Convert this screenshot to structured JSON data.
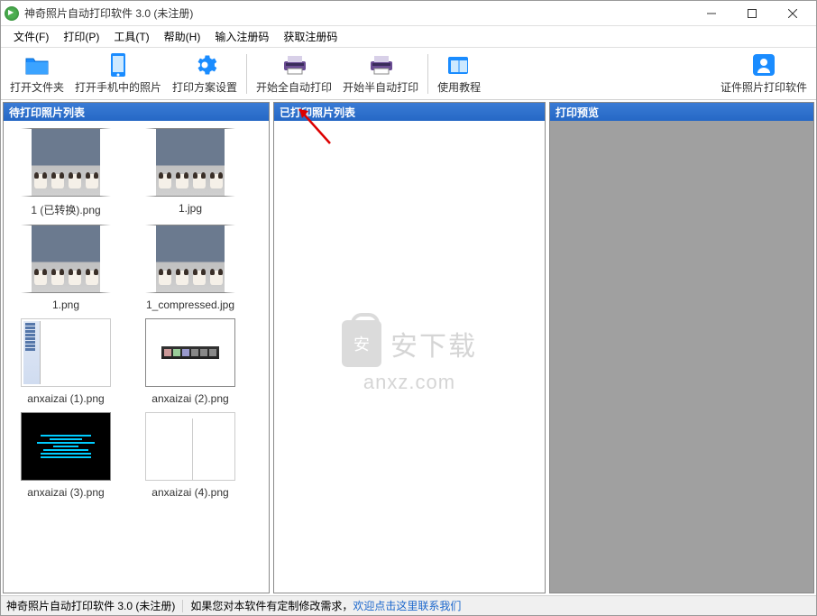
{
  "window": {
    "title": "神奇照片自动打印软件 3.0 (未注册)"
  },
  "menu": {
    "file": "文件(F)",
    "print": "打印(P)",
    "tools": "工具(T)",
    "help": "帮助(H)",
    "enter_reg": "输入注册码",
    "get_reg": "获取注册码"
  },
  "toolbar": {
    "open_folder": "打开文件夹",
    "open_phone": "打开手机中的照片",
    "print_plan": "打印方案设置",
    "start_auto": "开始全自动打印",
    "start_semi": "开始半自动打印",
    "tutorial": "使用教程",
    "id_photo": "证件照片打印软件"
  },
  "panels": {
    "pending": "待打印照片列表",
    "printed": "已打印照片列表",
    "preview": "打印预览"
  },
  "thumbs": [
    {
      "label": "1 (已转换).png",
      "kind": "puppy"
    },
    {
      "label": "1.jpg",
      "kind": "puppy"
    },
    {
      "label": "1.png",
      "kind": "puppy"
    },
    {
      "label": "1_compressed.jpg",
      "kind": "puppy"
    },
    {
      "label": "anxaizai (1).png",
      "kind": "screenshot"
    },
    {
      "label": "anxaizai (2).png",
      "kind": "darkbar"
    },
    {
      "label": "anxaizai (3).png",
      "kind": "terminal"
    },
    {
      "label": "anxaizai (4).png",
      "kind": "app"
    }
  ],
  "watermark": {
    "cn": "安下载",
    "url": "anxz.com"
  },
  "status": {
    "app": "神奇照片自动打印软件 3.0 (未注册)",
    "msg_prefix": "如果您对本软件有定制修改需求，",
    "msg_link": "欢迎点击这里联系我们"
  }
}
